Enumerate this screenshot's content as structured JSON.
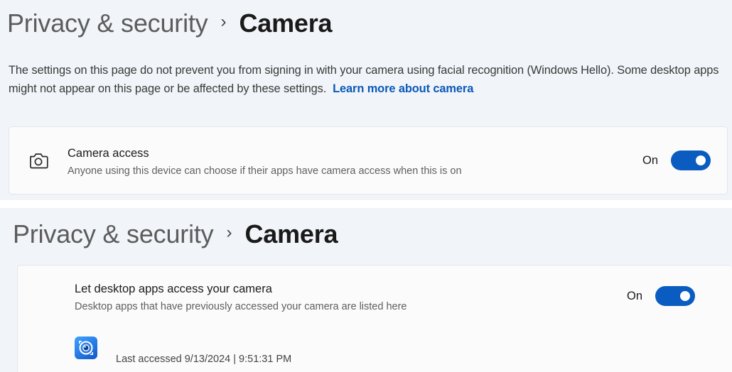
{
  "top_panel": {
    "breadcrumb": {
      "parent": "Privacy & security",
      "separator": "›",
      "current": "Camera"
    },
    "info": {
      "text": "The settings on this page do not prevent you from signing in with your camera using facial recognition (Windows Hello). Some desktop apps might not appear on this page or be affected by these settings.",
      "link": "Learn more about camera"
    },
    "camera_access": {
      "title": "Camera access",
      "description": "Anyone using this device can choose if their apps have camera access when this is on",
      "state": "On",
      "icon": "camera-icon"
    }
  },
  "bottom_panel": {
    "breadcrumb": {
      "parent": "Privacy & security",
      "separator": "›",
      "current": "Camera"
    },
    "desktop_apps": {
      "title": "Let desktop apps access your camera",
      "description": "Desktop apps that have previously accessed your camera are listed here",
      "state": "On"
    },
    "app_entry": {
      "icon": "camera-app-icon",
      "last_accessed": "Last accessed 9/13/2024  |  9:51:31 PM"
    }
  },
  "colors": {
    "accent": "#0a5cc0",
    "link": "#0a58b8",
    "background": "#f1f4f8",
    "card": "#fbfbfc"
  }
}
